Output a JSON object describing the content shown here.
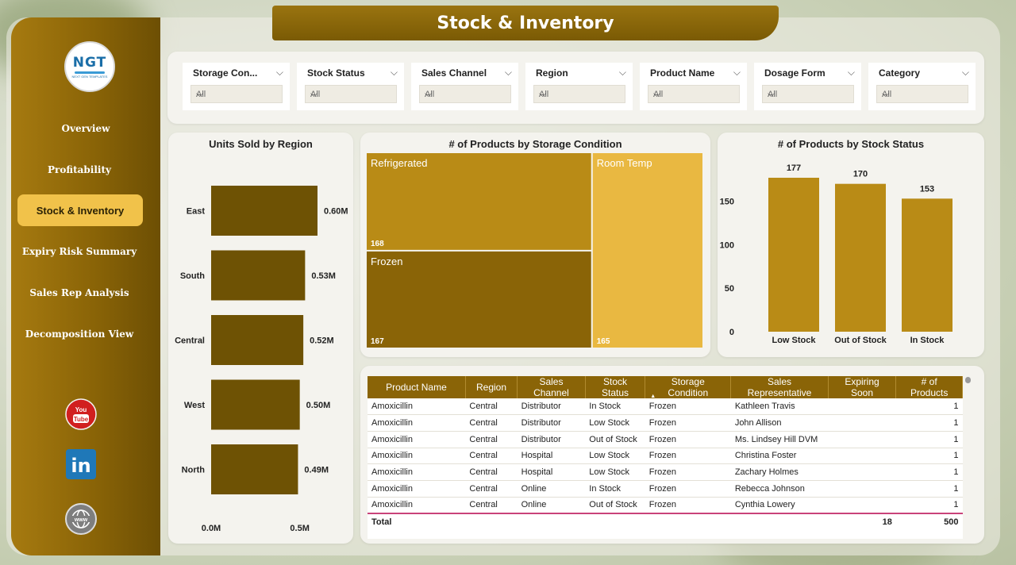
{
  "page_title": "Stock & Inventory",
  "logo": {
    "main": "NGT",
    "sub": "NEXT GEN TEMPLATES"
  },
  "nav": [
    {
      "label": "Overview",
      "active": false
    },
    {
      "label": "Profitability",
      "active": false
    },
    {
      "label": "Stock & Inventory",
      "active": true
    },
    {
      "label": "Expiry Risk Summary",
      "active": false
    },
    {
      "label": "Sales Rep Analysis",
      "active": false
    },
    {
      "label": "Decomposition View",
      "active": false
    }
  ],
  "social": [
    {
      "icon": "youtube-icon",
      "text": "You Tube"
    },
    {
      "icon": "linkedin-icon",
      "text": "in"
    },
    {
      "icon": "www-globe-icon",
      "text": "www"
    }
  ],
  "filters": [
    {
      "label": "Storage Con...",
      "value": "All"
    },
    {
      "label": "Stock Status",
      "value": "All"
    },
    {
      "label": "Sales Channel",
      "value": "All"
    },
    {
      "label": "Region",
      "value": "All"
    },
    {
      "label": "Product Name",
      "value": "All"
    },
    {
      "label": "Dosage Form",
      "value": "All"
    },
    {
      "label": "Category",
      "value": "All"
    }
  ],
  "colors": {
    "dark": "#6e5204",
    "gold": "#b98b16",
    "light_gold": "#e9b841",
    "accent": "#f1c24a"
  },
  "chart_data": [
    {
      "type": "bar",
      "orientation": "horizontal",
      "title": "Units Sold by Region",
      "categories": [
        "East",
        "South",
        "Central",
        "West",
        "North"
      ],
      "values": [
        0.6,
        0.53,
        0.52,
        0.5,
        0.49
      ],
      "data_labels": [
        "0.60M",
        "0.53M",
        "0.52M",
        "0.50M",
        "0.49M"
      ],
      "x_ticks": [
        "0.0M",
        "0.5M"
      ],
      "xlim": [
        0,
        0.6
      ]
    },
    {
      "type": "treemap",
      "title": "# of Products by Storage Condition",
      "categories": [
        "Refrigerated",
        "Frozen",
        "Room Temp"
      ],
      "values": [
        168,
        167,
        165
      ]
    },
    {
      "type": "bar",
      "title": "# of Products by Stock Status",
      "categories": [
        "Low Stock",
        "Out of Stock",
        "In Stock"
      ],
      "values": [
        177,
        170,
        153
      ],
      "y_ticks": [
        "0",
        "50",
        "100",
        "150"
      ],
      "ylim": [
        0,
        177
      ]
    }
  ],
  "table": {
    "columns": [
      "Product Name",
      "Region",
      "Sales Channel",
      "Stock Status",
      "Storage Condition",
      "Sales Representative",
      "Expiring Soon",
      "# of Products"
    ],
    "rows": [
      [
        "Amoxicillin",
        "Central",
        "Distributor",
        "In Stock",
        "Frozen",
        "Kathleen Travis",
        "",
        "1"
      ],
      [
        "Amoxicillin",
        "Central",
        "Distributor",
        "Low Stock",
        "Frozen",
        "John Allison",
        "",
        "1"
      ],
      [
        "Amoxicillin",
        "Central",
        "Distributor",
        "Out of Stock",
        "Frozen",
        "Ms. Lindsey Hill DVM",
        "",
        "1"
      ],
      [
        "Amoxicillin",
        "Central",
        "Hospital",
        "Low Stock",
        "Frozen",
        "Christina Foster",
        "",
        "1"
      ],
      [
        "Amoxicillin",
        "Central",
        "Hospital",
        "Low Stock",
        "Frozen",
        "Zachary Holmes",
        "",
        "1"
      ],
      [
        "Amoxicillin",
        "Central",
        "Online",
        "In Stock",
        "Frozen",
        "Rebecca Johnson",
        "",
        "1"
      ],
      [
        "Amoxicillin",
        "Central",
        "Online",
        "Out of Stock",
        "Frozen",
        "Cynthia Lowery",
        "",
        "1"
      ]
    ],
    "total": {
      "label": "Total",
      "expiring": "18",
      "products": "500"
    }
  }
}
